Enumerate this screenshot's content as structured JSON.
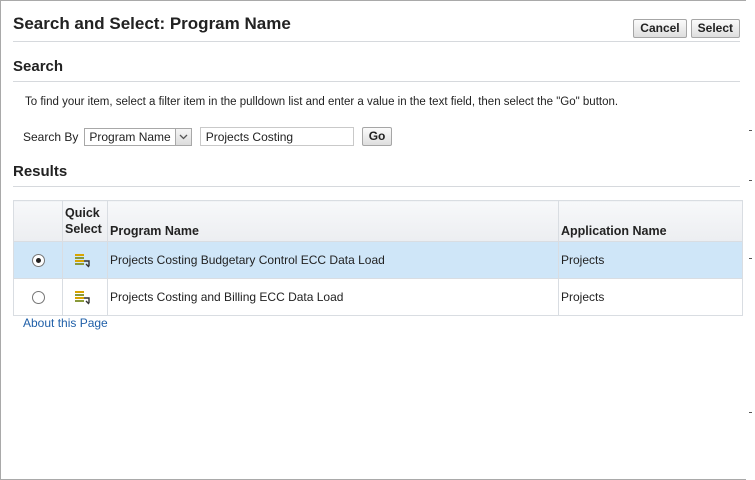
{
  "dialog": {
    "title": "Search and Select: Program Name",
    "cancel_label": "Cancel",
    "select_label": "Select"
  },
  "search": {
    "heading": "Search",
    "instructions": "To find your item, select a filter item in the pulldown list and enter a value in the text field, then select the \"Go\" button.",
    "search_by_label": "Search By",
    "filter_selected": "Program Name",
    "value": "Projects Costing",
    "go_label": "Go"
  },
  "results": {
    "heading": "Results",
    "columns": {
      "quick_select_line1": "Quick",
      "quick_select_line2": "Select",
      "program_name": "Program Name",
      "application_name": "Application Name"
    },
    "rows": [
      {
        "selected": true,
        "program_name": "Projects Costing Budgetary Control ECC Data Load",
        "application_name": "Projects"
      },
      {
        "selected": false,
        "program_name": "Projects Costing and Billing ECC Data Load",
        "application_name": "Projects"
      }
    ]
  },
  "footer": {
    "about_link": "About this Page"
  },
  "colors": {
    "selected_row": "#cfe6f8",
    "link": "#1f5fa8",
    "rule": "#d6d9dd"
  },
  "icons": {
    "quick_select": "quick-select-icon",
    "dropdown": "chevron-down-icon"
  }
}
